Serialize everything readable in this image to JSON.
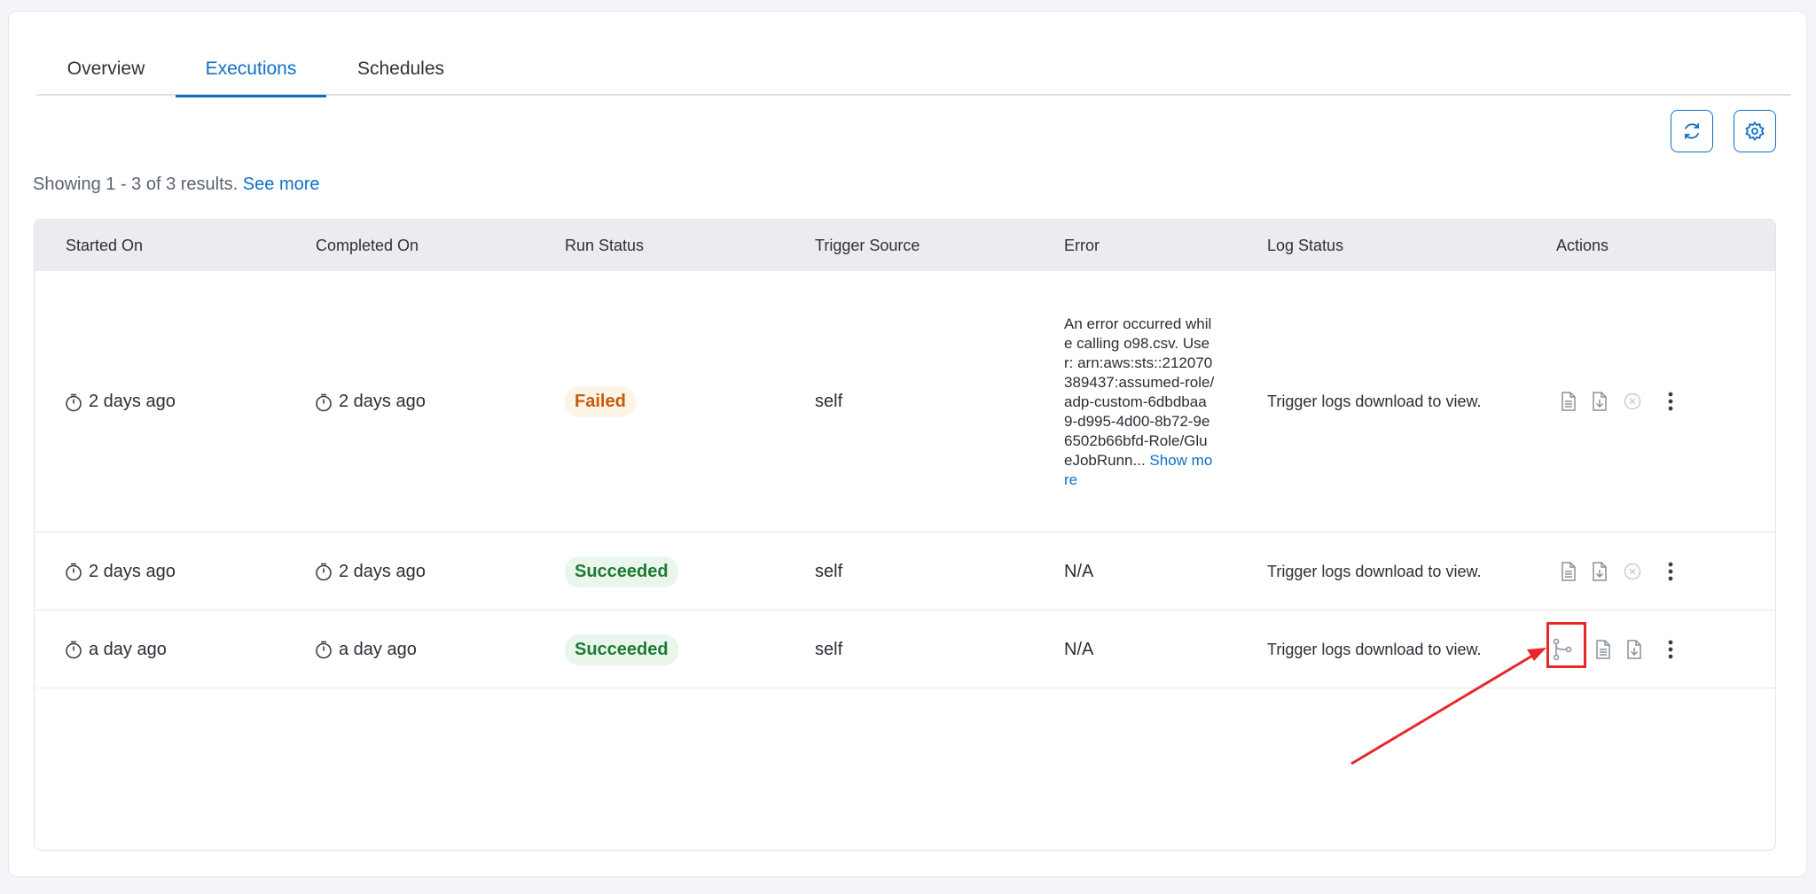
{
  "tabs": [
    "Overview",
    "Executions",
    "Schedules"
  ],
  "active_tab": "Executions",
  "results": {
    "text": "Showing 1 - 3 of 3 results.",
    "link": "See more"
  },
  "columns": [
    "Started On",
    "Completed On",
    "Run Status",
    "Trigger Source",
    "Error",
    "Log Status",
    "Actions"
  ],
  "rows": [
    {
      "started": "2 days ago",
      "completed": "2 days ago",
      "status": "Failed",
      "trigger": "self",
      "error": "An error occurred while calling o98.csv. User: arn:aws:sts::212070389437:assumed-role/adp-custom-6dbdbaa9-d995-4d00-8b72-9e6502b66bfd-Role/GlueJobRunn...",
      "error_more": "Show more",
      "log": "Trigger logs download to view."
    },
    {
      "started": "2 days ago",
      "completed": "2 days ago",
      "status": "Succeeded",
      "trigger": "self",
      "error": "N/A",
      "log": "Trigger logs download to view."
    },
    {
      "started": "a day ago",
      "completed": "a day ago",
      "status": "Succeeded",
      "trigger": "self",
      "error": "N/A",
      "log": "Trigger logs download to view."
    }
  ],
  "colors": {
    "accent": "#0f6fc6",
    "failed": "#c65a0a",
    "succeeded": "#1d7a33",
    "annotation": "#e8262b"
  },
  "icons": [
    "refresh-icon",
    "settings-icon",
    "clock-icon",
    "file-icon",
    "download-icon",
    "cancel-icon",
    "more-vertical-icon",
    "lineage-icon"
  ]
}
